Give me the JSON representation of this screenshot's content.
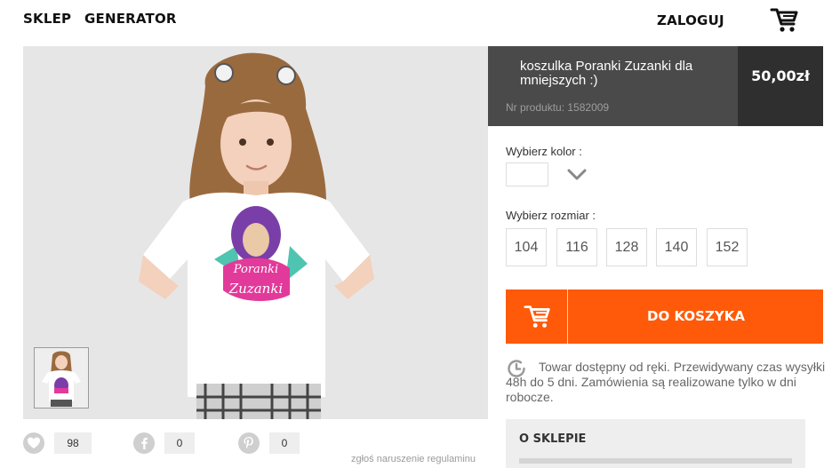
{
  "nav": {
    "shop": "SKLEP",
    "generator": "GENERATOR",
    "login": "ZALOGUJ",
    "cart_icon": "cart-icon"
  },
  "product": {
    "title": "koszulka Poranki Zuzanki dla mniejszych :)",
    "sku_label": "Nr produktu:",
    "sku": "1582009",
    "price": "50,00zł",
    "print_text_line1": "Poranki",
    "print_text_line2": "Zuzanki"
  },
  "options": {
    "color_label": "Wybierz kolor :",
    "selected_color": "#ffffff",
    "size_label": "Wybierz rozmiar :",
    "sizes": [
      "104",
      "116",
      "128",
      "140",
      "152"
    ]
  },
  "actions": {
    "add_to_cart": "DO KOSZYKA"
  },
  "availability": "Towar dostępny od ręki. Przewidywany czas wysyłki 48h do 5 dni. Zamówienia są realizowane tylko w dni robocze.",
  "social": {
    "likes": "98",
    "facebook": "0",
    "pinterest": "0"
  },
  "report": "zgłoś naruszenie regulaminu",
  "about": {
    "title": "O SKLEPIE"
  },
  "colors": {
    "accent": "#ff5a0a",
    "title_bg": "#4a4a4a",
    "price_bg": "#2f2f2f"
  }
}
